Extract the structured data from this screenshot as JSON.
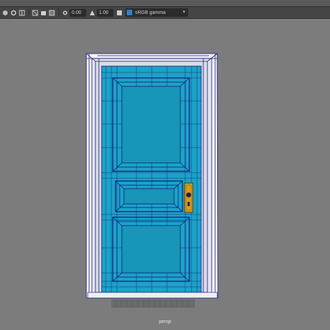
{
  "toolbar": {
    "exposure_value": "0.00",
    "gamma_value": "1.00",
    "color_space": "sRGB gamma",
    "icons": [
      "camera-icon",
      "film-gate-icon",
      "grid-icon",
      "wireframe-icon",
      "isolate-icon",
      "xray-icon",
      "exposure-icon",
      "gamma-icon",
      "color-management-icon"
    ]
  },
  "viewport": {
    "camera_name": "persp",
    "colors": {
      "background": "#7c7c7c",
      "door_fill": "#1ba3c6",
      "wireframe": "#14147a",
      "frame": "#f2f2f6",
      "handle": "#d99a1e"
    }
  }
}
